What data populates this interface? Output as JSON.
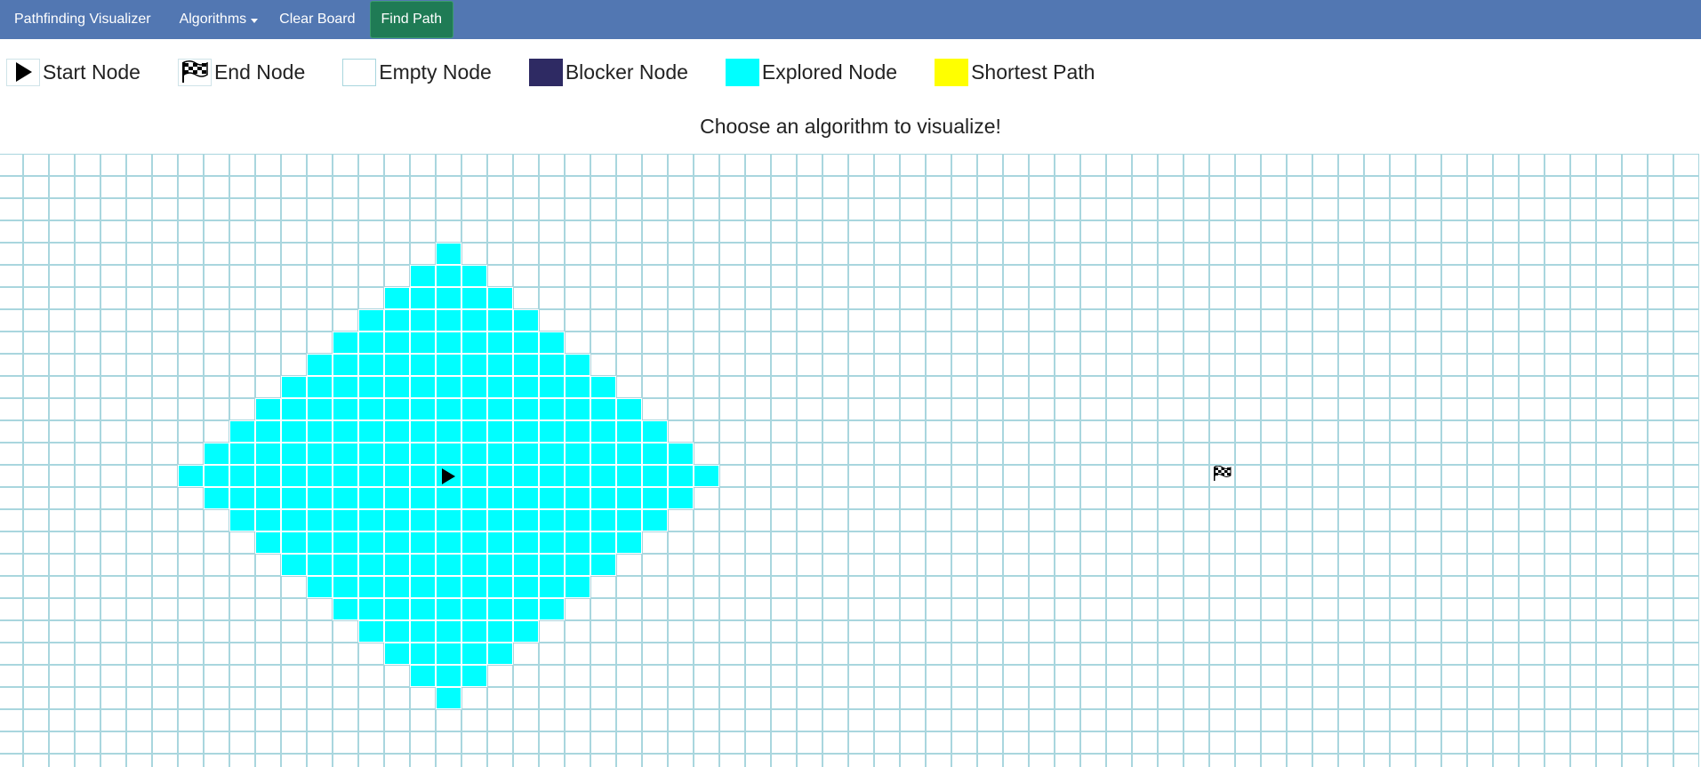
{
  "navbar": {
    "brand": "Pathfinding Visualizer",
    "algorithms_label": "Algorithms",
    "clear_label": "Clear Board",
    "find_label": "Find Path",
    "background_color": "#5277b2",
    "find_button_color": "#1f7b55"
  },
  "legend": [
    {
      "key": "start",
      "label": "Start Node",
      "icon": "play-icon"
    },
    {
      "key": "end",
      "label": "End Node",
      "icon": "checkered-flag-icon"
    },
    {
      "key": "empty",
      "label": "Empty Node",
      "color": "#ffffff"
    },
    {
      "key": "blocker",
      "label": "Blocker Node",
      "color": "#2e2a63"
    },
    {
      "key": "explored",
      "label": "Explored Node",
      "color": "#00ffff"
    },
    {
      "key": "shortest",
      "label": "Shortest Path",
      "color": "#ffff00"
    }
  ],
  "message": "Choose an algorithm to visualize!",
  "grid": {
    "columns": 66,
    "rows": 28,
    "start": {
      "row": 14,
      "col": 17
    },
    "end": {
      "row": 14,
      "col": 47
    },
    "explored_radius": 10,
    "cell_border_color": "#a9d6de",
    "explored_color": "#00ffff"
  }
}
